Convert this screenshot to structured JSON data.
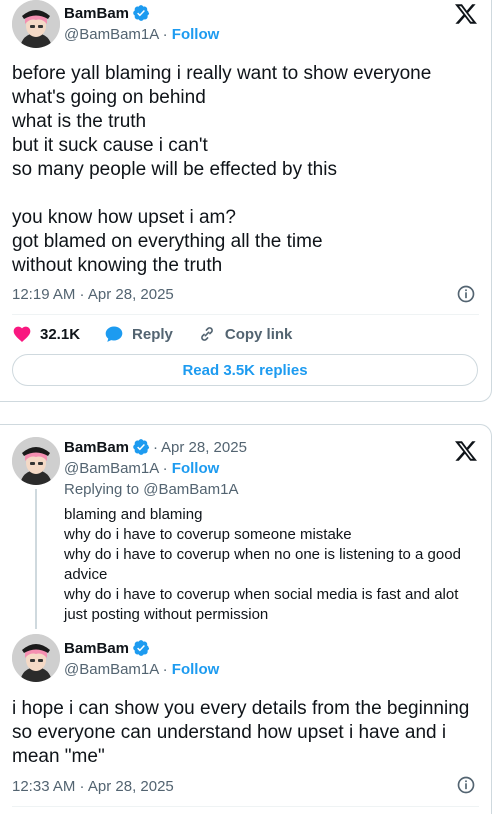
{
  "main_tweet": {
    "author_name": "BamBam",
    "handle": "@BamBam1A",
    "separator": "·",
    "follow_label": "Follow",
    "text": "before yall blaming i really want to show everyone\nwhat's going on behind\nwhat is the truth\nbut it suck cause i can't\nso many people will be effected by this\n\nyou know how upset i am?\ngot blamed on everything all the time\nwithout knowing the truth",
    "timestamp": "12:19 AM · Apr 28, 2025",
    "likes": "32.1K",
    "reply_label": "Reply",
    "copy_link_label": "Copy link",
    "read_replies_label": "Read 3.5K replies"
  },
  "quoted_thread": {
    "parent": {
      "author_name": "BamBam",
      "handle": "@BamBam1A",
      "separator": "·",
      "date": "Apr 28, 2025",
      "follow_label": "Follow",
      "replying_to": "Replying to @BamBam1A",
      "text": "blaming and blaming\nwhy do i have to coverup someone mistake\nwhy do i have to coverup when no one is listening to a good advice\nwhy do i have to coverup when social media is fast and alot just posting without permission"
    },
    "reply": {
      "author_name": "BamBam",
      "handle": "@BamBam1A",
      "separator": "·",
      "follow_label": "Follow",
      "text": "i hope i can show you every details from the beginning so everyone can understand how upset i have and i mean \"me\"",
      "timestamp": "12:33 AM · Apr 28, 2025"
    }
  },
  "colors": {
    "accent": "#1d9bf0",
    "like": "#f91880",
    "muted": "#536471",
    "text": "#0f1419"
  },
  "icons": [
    "verified-badge-icon",
    "x-logo-icon",
    "info-icon",
    "heart-icon",
    "reply-bubble-icon",
    "link-icon"
  ]
}
